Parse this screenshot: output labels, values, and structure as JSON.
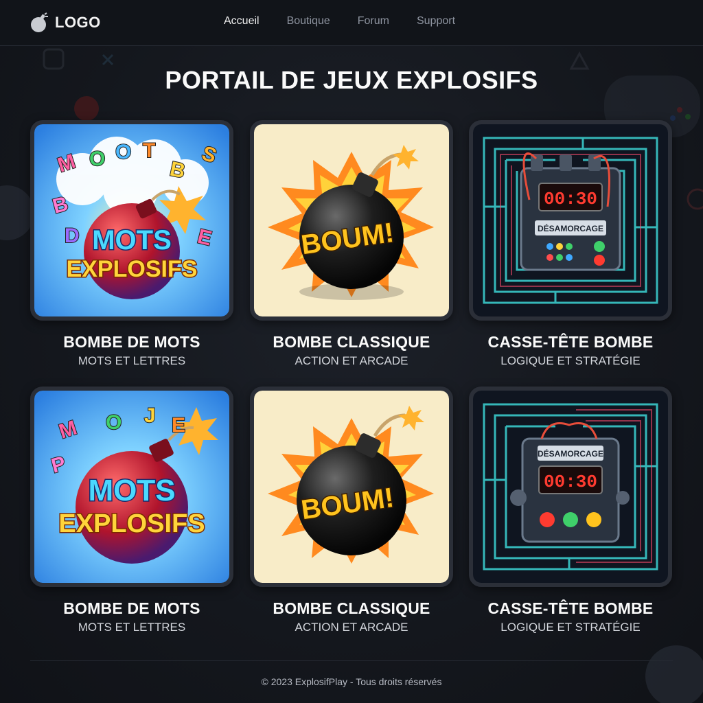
{
  "header": {
    "logo_text": "LOGO",
    "nav": [
      {
        "label": "Accueil",
        "active": true
      },
      {
        "label": "Boutique",
        "active": false
      },
      {
        "label": "Forum",
        "active": false
      },
      {
        "label": "Support",
        "active": false
      }
    ]
  },
  "page": {
    "title": "PORTAIL DE JEUX EXPLOSIFS"
  },
  "games": [
    {
      "title": "BOMBE DE MOTS",
      "subtitle": "MOTS ET LETTRES",
      "art_text": [
        "MOTS",
        "EXPLOSIFS"
      ],
      "art_letters": "MOOTBSE"
    },
    {
      "title": "BOMBE CLASSIQUE",
      "subtitle": "ACTION ET ARCADE",
      "art_text": [
        "BOUM!"
      ]
    },
    {
      "title": "CASSE-TÊTE BOMBE",
      "subtitle": "LOGIQUE ET STRATÉGIE",
      "art_text": [
        "00:30",
        "DÉSAMORCAGE"
      ]
    },
    {
      "title": "BOMBE DE MOTS",
      "subtitle": "MOTS ET LETTRES",
      "art_text": [
        "MOTS",
        "EXPLOSIFS"
      ],
      "art_letters": "MOJEP"
    },
    {
      "title": "BOMBE CLASSIQUE",
      "subtitle": "ACTION ET ARCADE",
      "art_text": [
        "BOUM!"
      ]
    },
    {
      "title": "CASSE-TÊTE BOMBE",
      "subtitle": "LOGIQUE ET STRATÉGIE",
      "art_text": [
        "DÉSAMORCAGE",
        "00:30"
      ]
    }
  ],
  "footer": {
    "text": "© 2023 ExplosifPlay - Tous droits réservés"
  },
  "colors": {
    "background": "#14171d",
    "header": "#111419",
    "card_border": "#2b2f38",
    "neon": "#3fe0e0",
    "timer_red": "#ff3b30"
  }
}
